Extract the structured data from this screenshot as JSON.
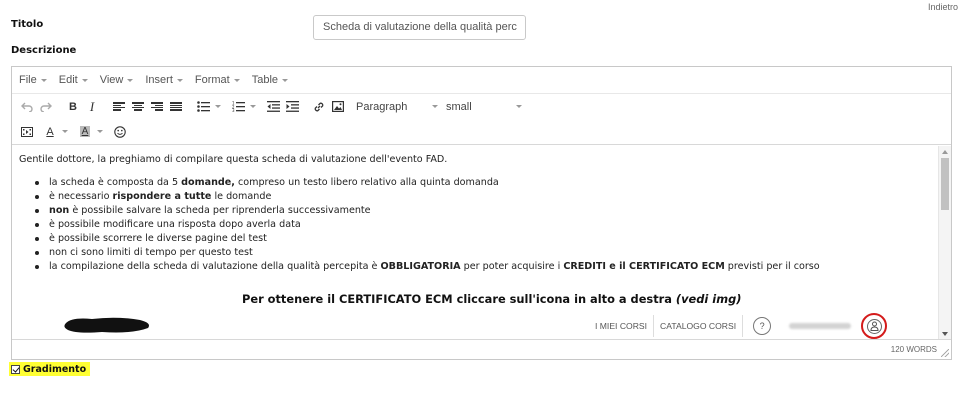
{
  "header": {
    "back_link": "Indietro"
  },
  "form": {
    "title_label": "Titolo",
    "title_value": "Scheda di valutazione della qualità perc",
    "description_label": "Descrizione",
    "checkbox_label": "Gradimento",
    "checkbox_checked": true
  },
  "editor": {
    "menu": [
      "File",
      "Edit",
      "View",
      "Insert",
      "Format",
      "Table"
    ],
    "block_format": "Paragraph",
    "font_size": "small",
    "word_count": "120 WORDS",
    "content": {
      "intro": "Gentile dottore, la preghiamo di compilare questa scheda di valutazione dell'evento FAD.",
      "bullets": [
        {
          "pre": "la scheda è composta da 5 ",
          "bold": "domande,",
          "post": " compreso un testo libero relativo alla quinta domanda"
        },
        {
          "pre": "è necessario ",
          "bold": "rispondere a tutte",
          "post": " le domande"
        },
        {
          "pre": "",
          "bold": "non",
          "post": " è possibile salvare la scheda per riprenderla successivamente"
        },
        {
          "pre": "è possibile modificare una risposta dopo averla data",
          "bold": "",
          "post": ""
        },
        {
          "pre": "è possibile scorrere le diverse pagine del test",
          "bold": "",
          "post": ""
        },
        {
          "pre": "non ci sono limiti di tempo per questo test",
          "bold": "",
          "post": ""
        },
        {
          "pre": "la compilazione della scheda di valutazione della qualità percepita è ",
          "bold": "OBBLIGATORIA",
          "post": " per poter acquisire i ",
          "bold2": "CREDITI e il CERTIFICATO ECM",
          "post2": " previsti per il corso"
        }
      ],
      "cert_text": "Per ottenere il CERTIFICATO ECM cliccare sull'icona in alto a destra ",
      "cert_italic": "(vedi img)",
      "image_nav": {
        "my_courses": "I MIEI CORSI",
        "catalog": "CATALOGO CORSI",
        "help": "?"
      }
    }
  },
  "colors": {
    "highlight": "#ffff33",
    "ring": "#d41b1b"
  }
}
